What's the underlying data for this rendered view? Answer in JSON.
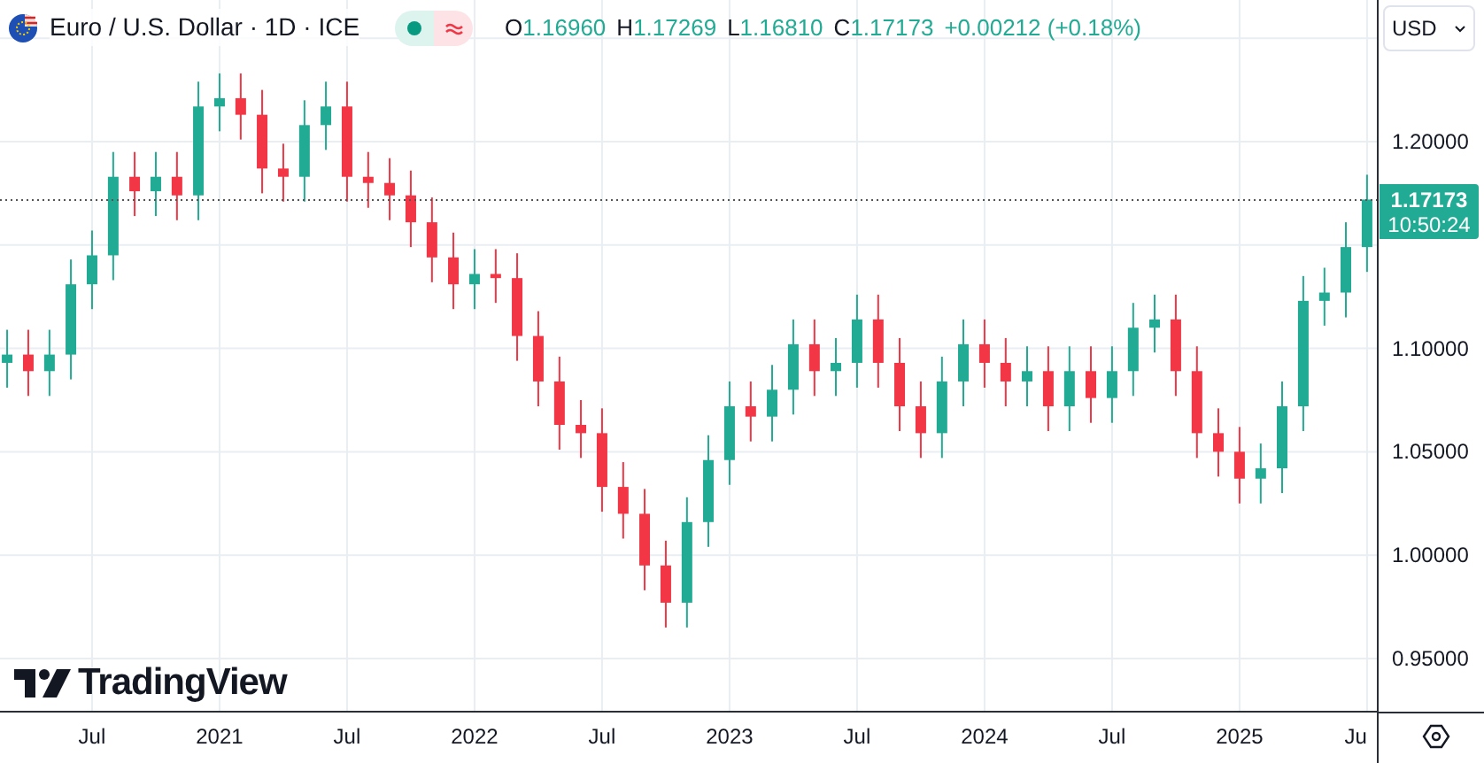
{
  "header": {
    "symbol": "Euro / U.S. Dollar · 1D · ICE",
    "market_open": true,
    "ohlc": [
      {
        "label": "O",
        "value": "1.16960"
      },
      {
        "label": "H",
        "value": "1.17269"
      },
      {
        "label": "L",
        "value": "1.16810"
      },
      {
        "label": "C",
        "value": "1.17173"
      }
    ],
    "change": "+0.00212 (+0.18%)"
  },
  "currency": "USD",
  "price_label": {
    "price": "1.17173",
    "countdown": "10:50:24"
  },
  "logo": "TradingView",
  "chart_data": {
    "type": "candlestick",
    "grid": true,
    "x": [
      2020.167,
      2020.25,
      2020.333,
      2020.417,
      2020.5,
      2020.583,
      2020.667,
      2020.75,
      2020.833,
      2020.917,
      2021,
      2021.083,
      2021.167,
      2021.25,
      2021.333,
      2021.417,
      2021.5,
      2021.583,
      2021.667,
      2021.75,
      2021.833,
      2021.917,
      2022,
      2022.083,
      2022.167,
      2022.25,
      2022.333,
      2022.417,
      2022.5,
      2022.583,
      2022.667,
      2022.75,
      2022.833,
      2022.917,
      2023,
      2023.083,
      2023.167,
      2023.25,
      2023.333,
      2023.417,
      2023.5,
      2023.583,
      2023.667,
      2023.75,
      2023.833,
      2023.917,
      2024,
      2024.083,
      2024.167,
      2024.25,
      2024.333,
      2024.417,
      2024.5,
      2024.583,
      2024.667,
      2024.75,
      2024.833,
      2024.917,
      2025,
      2025.083,
      2025.167,
      2025.25,
      2025.333,
      2025.417,
      2025.5
    ],
    "ohlc": [
      [
        1.093,
        1.109,
        1.081,
        1.097
      ],
      [
        1.097,
        1.109,
        1.077,
        1.089
      ],
      [
        1.089,
        1.109,
        1.077,
        1.097
      ],
      [
        1.097,
        1.143,
        1.085,
        1.131
      ],
      [
        1.131,
        1.157,
        1.119,
        1.145
      ],
      [
        1.145,
        1.195,
        1.133,
        1.183
      ],
      [
        1.183,
        1.195,
        1.164,
        1.176
      ],
      [
        1.176,
        1.195,
        1.164,
        1.183
      ],
      [
        1.183,
        1.195,
        1.162,
        1.174
      ],
      [
        1.174,
        1.229,
        1.162,
        1.217
      ],
      [
        1.217,
        1.233,
        1.205,
        1.221
      ],
      [
        1.221,
        1.233,
        1.201,
        1.213
      ],
      [
        1.213,
        1.225,
        1.175,
        1.187
      ],
      [
        1.187,
        1.199,
        1.171,
        1.183
      ],
      [
        1.183,
        1.22,
        1.171,
        1.208
      ],
      [
        1.208,
        1.229,
        1.196,
        1.217
      ],
      [
        1.217,
        1.229,
        1.171,
        1.183
      ],
      [
        1.183,
        1.195,
        1.168,
        1.18
      ],
      [
        1.18,
        1.192,
        1.162,
        1.174
      ],
      [
        1.174,
        1.186,
        1.149,
        1.161
      ],
      [
        1.161,
        1.173,
        1.132,
        1.144
      ],
      [
        1.144,
        1.156,
        1.119,
        1.131
      ],
      [
        1.131,
        1.148,
        1.119,
        1.136
      ],
      [
        1.136,
        1.148,
        1.122,
        1.134
      ],
      [
        1.134,
        1.146,
        1.094,
        1.106
      ],
      [
        1.106,
        1.118,
        1.072,
        1.084
      ],
      [
        1.084,
        1.096,
        1.051,
        1.063
      ],
      [
        1.063,
        1.075,
        1.047,
        1.059
      ],
      [
        1.059,
        1.071,
        1.021,
        1.033
      ],
      [
        1.033,
        1.045,
        1.008,
        1.02
      ],
      [
        1.02,
        1.032,
        0.983,
        0.995
      ],
      [
        0.995,
        1.007,
        0.965,
        0.977
      ],
      [
        0.977,
        1.028,
        0.965,
        1.016
      ],
      [
        1.016,
        1.058,
        1.004,
        1.046
      ],
      [
        1.046,
        1.084,
        1.034,
        1.072
      ],
      [
        1.072,
        1.084,
        1.055,
        1.067
      ],
      [
        1.067,
        1.092,
        1.055,
        1.08
      ],
      [
        1.08,
        1.114,
        1.068,
        1.102
      ],
      [
        1.102,
        1.114,
        1.077,
        1.089
      ],
      [
        1.089,
        1.105,
        1.077,
        1.093
      ],
      [
        1.093,
        1.126,
        1.081,
        1.114
      ],
      [
        1.114,
        1.126,
        1.081,
        1.093
      ],
      [
        1.093,
        1.105,
        1.06,
        1.072
      ],
      [
        1.072,
        1.084,
        1.047,
        1.059
      ],
      [
        1.059,
        1.096,
        1.047,
        1.084
      ],
      [
        1.084,
        1.114,
        1.072,
        1.102
      ],
      [
        1.102,
        1.114,
        1.081,
        1.093
      ],
      [
        1.093,
        1.105,
        1.072,
        1.084
      ],
      [
        1.084,
        1.101,
        1.072,
        1.089
      ],
      [
        1.089,
        1.101,
        1.06,
        1.072
      ],
      [
        1.072,
        1.101,
        1.06,
        1.089
      ],
      [
        1.089,
        1.101,
        1.064,
        1.076
      ],
      [
        1.076,
        1.101,
        1.064,
        1.089
      ],
      [
        1.089,
        1.122,
        1.077,
        1.11
      ],
      [
        1.11,
        1.126,
        1.098,
        1.114
      ],
      [
        1.114,
        1.126,
        1.077,
        1.089
      ],
      [
        1.089,
        1.101,
        1.047,
        1.059
      ],
      [
        1.059,
        1.071,
        1.038,
        1.05
      ],
      [
        1.05,
        1.062,
        1.025,
        1.037
      ],
      [
        1.037,
        1.054,
        1.025,
        1.042
      ],
      [
        1.042,
        1.084,
        1.03,
        1.072
      ],
      [
        1.072,
        1.135,
        1.06,
        1.123
      ],
      [
        1.123,
        1.139,
        1.111,
        1.127
      ],
      [
        1.127,
        1.161,
        1.115,
        1.149
      ],
      [
        1.149,
        1.184,
        1.137,
        1.172
      ]
    ],
    "xlim": [
      2020.139,
      2025.542
    ],
    "ylim": [
      0.9243,
      1.2685
    ],
    "xticks": [
      {
        "value": 2020.5,
        "label": "Jul"
      },
      {
        "value": 2021,
        "label": "2021"
      },
      {
        "value": 2021.5,
        "label": "Jul"
      },
      {
        "value": 2022,
        "label": "2022"
      },
      {
        "value": 2022.5,
        "label": "Jul"
      },
      {
        "value": 2023,
        "label": "2023"
      },
      {
        "value": 2023.5,
        "label": "Jul"
      },
      {
        "value": 2024,
        "label": "2024"
      },
      {
        "value": 2024.5,
        "label": "Jul"
      },
      {
        "value": 2025,
        "label": "2025"
      },
      {
        "value": 2025.5,
        "label": "Ju"
      }
    ],
    "yticks": [
      {
        "value": 0.95,
        "label": "0.95000"
      },
      {
        "value": 1.0,
        "label": "1.00000"
      },
      {
        "value": 1.05,
        "label": "1.05000"
      },
      {
        "value": 1.1,
        "label": "1.10000"
      },
      {
        "value": 1.2,
        "label": "1.20000"
      }
    ],
    "ref_lines": [
      {
        "axis": "y",
        "value": 1.17173
      }
    ]
  }
}
